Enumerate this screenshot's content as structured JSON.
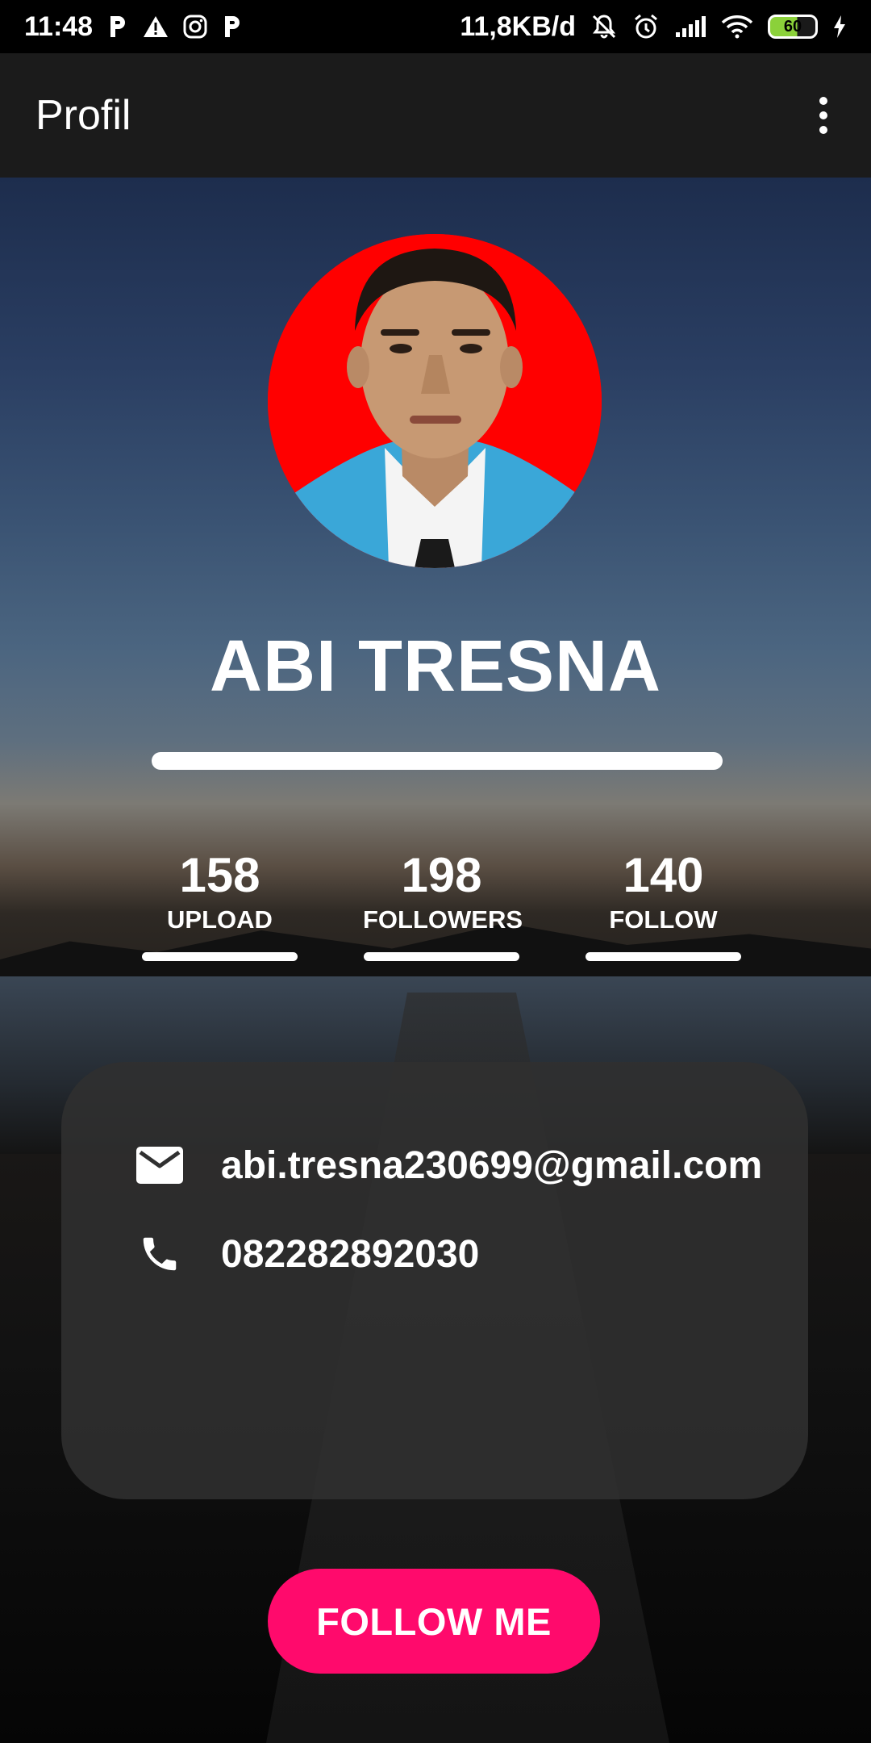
{
  "status_bar": {
    "time": "11:48",
    "network_speed": "11,8KB/d",
    "battery": "60",
    "left_icons": [
      "p-app-icon",
      "warning-icon",
      "instagram-icon",
      "p-app-icon"
    ],
    "right_icons": [
      "mute-bell-icon",
      "alarm-icon",
      "signal-icon",
      "wifi-icon",
      "charging-icon"
    ]
  },
  "app_bar": {
    "title": "Profil",
    "menu_icon": "more-vert-icon"
  },
  "profile": {
    "name": "ABI TRESNA",
    "avatar_background": "#ff0000"
  },
  "stats": [
    {
      "value": "158",
      "label": "UPLOAD"
    },
    {
      "value": "198",
      "label": "FOLLOWERS"
    },
    {
      "value": "140",
      "label": "FOLLOW"
    }
  ],
  "contact": {
    "email": "abi.tresna230699@gmail.com",
    "phone": "082282892030",
    "email_icon": "email-icon",
    "phone_icon": "phone-icon"
  },
  "follow_button": {
    "label": "FOLLOW ME",
    "color": "#ff0a6c"
  }
}
